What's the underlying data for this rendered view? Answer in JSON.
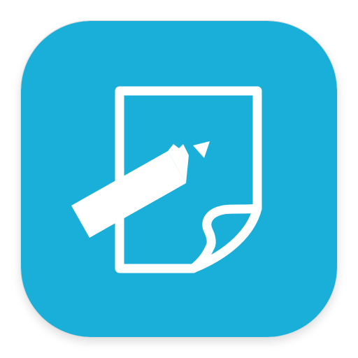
{
  "app_icon": {
    "icon": "notes-edit-icon",
    "glyph": "document-with-pencil",
    "colors": {
      "background": "#1AAFD9",
      "foreground": "#FFFFFF",
      "shadow": "#DCDCDC"
    }
  }
}
